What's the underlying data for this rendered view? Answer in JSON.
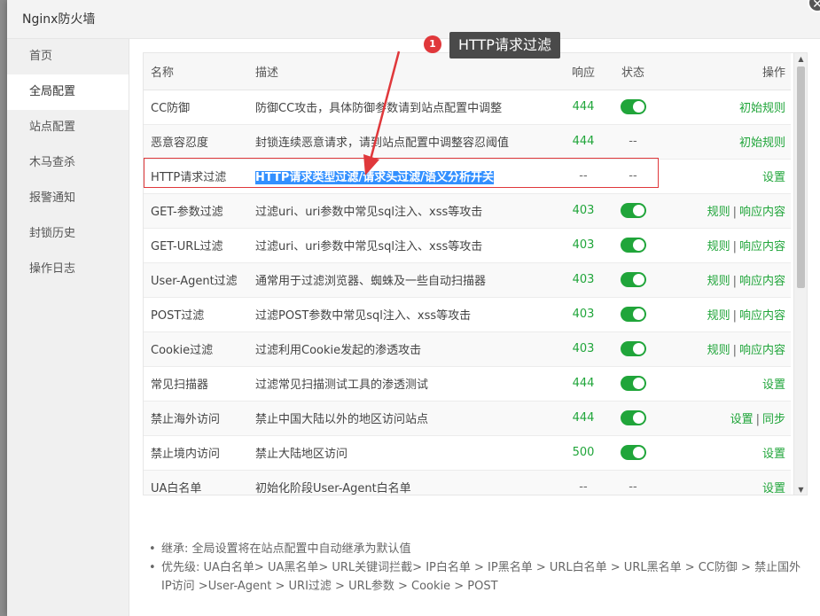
{
  "window": {
    "title": "Nginx防火墙"
  },
  "sidebar": {
    "items": [
      {
        "label": "首页"
      },
      {
        "label": "全局配置"
      },
      {
        "label": "站点配置"
      },
      {
        "label": "木马查杀"
      },
      {
        "label": "报警通知"
      },
      {
        "label": "封锁历史"
      },
      {
        "label": "操作日志"
      }
    ],
    "active_index": 1
  },
  "table": {
    "headers": {
      "name": "名称",
      "desc": "描述",
      "resp": "响应",
      "state": "状态",
      "op": "操作"
    },
    "rows": [
      {
        "name": "CC防御",
        "desc": "防御CC攻击，具体防御参数请到站点配置中调整",
        "resp": "444",
        "state": "on",
        "ops": [
          "初始规则"
        ]
      },
      {
        "name": "恶意容忍度",
        "desc": "封锁连续恶意请求，请到站点配置中调整容忍阈值",
        "resp": "444",
        "state": "--",
        "ops": [
          "初始规则"
        ]
      },
      {
        "name": "HTTP请求过滤",
        "desc": "HTTP请求类型过滤/请求头过滤/语义分析开关",
        "resp": "--",
        "state": "--",
        "ops": [
          "设置"
        ]
      },
      {
        "name": "GET-参数过滤",
        "desc": "过滤uri、uri参数中常见sql注入、xss等攻击",
        "resp": "403",
        "state": "on",
        "ops": [
          "规则",
          "响应内容"
        ]
      },
      {
        "name": "GET-URL过滤",
        "desc": "过滤uri、uri参数中常见sql注入、xss等攻击",
        "resp": "403",
        "state": "on",
        "ops": [
          "规则",
          "响应内容"
        ]
      },
      {
        "name": "User-Agent过滤",
        "desc": "通常用于过滤浏览器、蜘蛛及一些自动扫描器",
        "resp": "403",
        "state": "on",
        "ops": [
          "规则",
          "响应内容"
        ]
      },
      {
        "name": "POST过滤",
        "desc": "过滤POST参数中常见sql注入、xss等攻击",
        "resp": "403",
        "state": "on",
        "ops": [
          "规则",
          "响应内容"
        ]
      },
      {
        "name": "Cookie过滤",
        "desc": "过滤利用Cookie发起的渗透攻击",
        "resp": "403",
        "state": "on",
        "ops": [
          "规则",
          "响应内容"
        ]
      },
      {
        "name": "常见扫描器",
        "desc": "过滤常见扫描测试工具的渗透测试",
        "resp": "444",
        "state": "on",
        "ops": [
          "设置"
        ]
      },
      {
        "name": "禁止海外访问",
        "desc": "禁止中国大陆以外的地区访问站点",
        "resp": "444",
        "state": "on",
        "ops": [
          "设置",
          "同步"
        ]
      },
      {
        "name": "禁止境内访问",
        "desc": "禁止大陆地区访问",
        "resp": "500",
        "state": "on",
        "ops": [
          "设置"
        ]
      },
      {
        "name": "UA白名单",
        "desc": "初始化阶段User-Agent白名单",
        "resp": "--",
        "state": "--",
        "ops": [
          "设置"
        ]
      }
    ],
    "highlighted_row": 2
  },
  "callout": {
    "number": "1",
    "text": "HTTP请求过滤"
  },
  "notes": [
    "继承: 全局设置将在站点配置中自动继承为默认值",
    "优先级: UA白名单> UA黑名单> URL关键词拦截> IP白名单 > IP黑名单 > URL白名单 > URL黑名单 > CC防御 > 禁止国外IP访问 >User-Agent > URI过滤 > URL参数 > Cookie > POST"
  ],
  "colors": {
    "accent": "#20a53a",
    "highlight_box": "#e0383b",
    "selection": "#3390ff"
  },
  "icons": {
    "close": "close-icon",
    "toggle": "toggle-switch",
    "scroll_up": "scroll-up-arrow",
    "scroll_down": "scroll-down-arrow"
  }
}
